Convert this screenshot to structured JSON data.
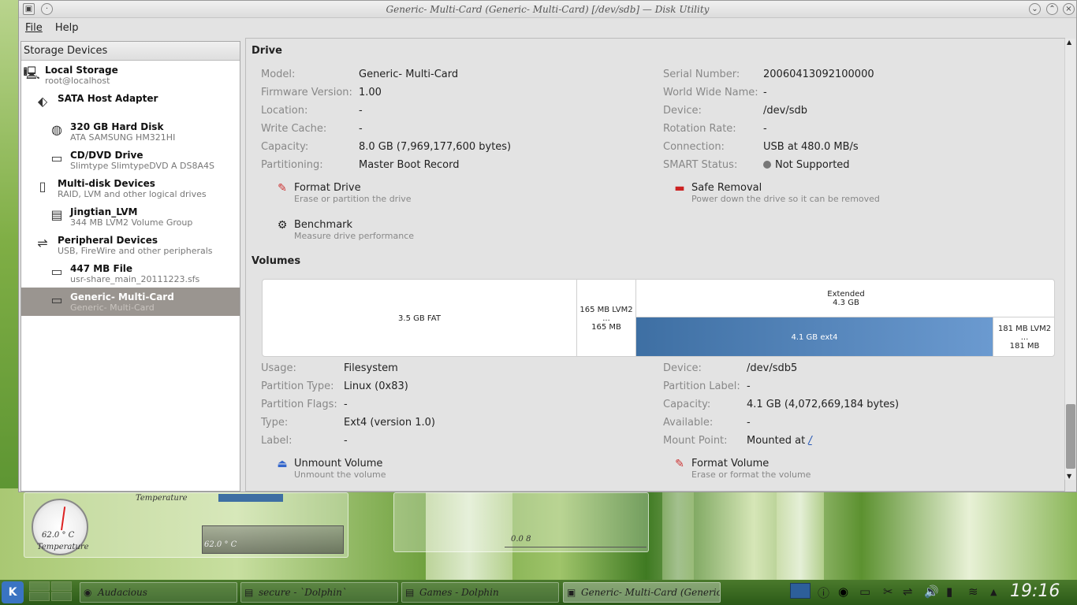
{
  "window": {
    "title": "Generic- Multi-Card (Generic- Multi-Card) [/dev/sdb] — Disk Utility"
  },
  "menu": {
    "file": "File",
    "help": "Help"
  },
  "sidebar": {
    "header": "Storage Devices",
    "items": [
      {
        "name": "Local Storage",
        "sub": "root@localhost",
        "icon": "computer-icon"
      },
      {
        "name": "SATA Host Adapter",
        "sub": "",
        "icon": "sata-adapter-icon"
      },
      {
        "name": "320 GB Hard Disk",
        "sub": "ATA SAMSUNG HM321HI",
        "icon": "harddisk-icon"
      },
      {
        "name": "CD/DVD Drive",
        "sub": "Slimtype SlimtypeDVD A DS8A4S",
        "icon": "optical-drive-icon"
      },
      {
        "name": "Multi-disk Devices",
        "sub": "RAID, LVM and other logical drives",
        "icon": "multidisk-icon"
      },
      {
        "name": "Jingtian_LVM",
        "sub": "344 MB LVM2 Volume Group",
        "icon": "lvm-icon"
      },
      {
        "name": "Peripheral Devices",
        "sub": "USB, FireWire and other peripherals",
        "icon": "usb-icon"
      },
      {
        "name": "447 MB File",
        "sub": "usr-share_main_20111223.sfs",
        "icon": "file-drive-icon"
      },
      {
        "name": "Generic- Multi-Card",
        "sub": "Generic- Multi-Card",
        "icon": "card-reader-icon"
      }
    ]
  },
  "drive": {
    "heading": "Drive",
    "left": [
      {
        "k": "Model:",
        "v": "Generic- Multi-Card"
      },
      {
        "k": "Firmware Version:",
        "v": "1.00"
      },
      {
        "k": "Location:",
        "v": "-"
      },
      {
        "k": "Write Cache:",
        "v": "-"
      },
      {
        "k": "Capacity:",
        "v": "8.0 GB (7,969,177,600 bytes)"
      },
      {
        "k": "Partitioning:",
        "v": "Master Boot Record"
      }
    ],
    "right": [
      {
        "k": "Serial Number:",
        "v": "20060413092100000"
      },
      {
        "k": "World Wide Name:",
        "v": "-"
      },
      {
        "k": "Device:",
        "v": "/dev/sdb"
      },
      {
        "k": "Rotation Rate:",
        "v": "-"
      },
      {
        "k": "Connection:",
        "v": "USB at 480.0 MB/s"
      },
      {
        "k": "SMART Status:",
        "v": "Not Supported"
      }
    ],
    "actions": {
      "format": {
        "name": "Format Drive",
        "desc": "Erase or partition the drive"
      },
      "safe": {
        "name": "Safe Removal",
        "desc": "Power down the drive so it can be removed"
      },
      "bench": {
        "name": "Benchmark",
        "desc": "Measure drive performance"
      }
    }
  },
  "volumes": {
    "heading": "Volumes",
    "segments": {
      "fat": "3.5 GB FAT",
      "lvm1a": "165 MB LVM2 ...",
      "lvm1b": "165 MB",
      "ext_title": "Extended",
      "ext_size": "4.3 GB",
      "ext4": "4.1 GB ext4",
      "lvm2a": "181 MB LVM2 ...",
      "lvm2b": "181 MB"
    },
    "left": [
      {
        "k": "Usage:",
        "v": "Filesystem"
      },
      {
        "k": "Partition Type:",
        "v": "Linux (0x83)"
      },
      {
        "k": "Partition Flags:",
        "v": "-"
      },
      {
        "k": "Type:",
        "v": "Ext4 (version 1.0)"
      },
      {
        "k": "Label:",
        "v": "-"
      }
    ],
    "right": [
      {
        "k": "Device:",
        "v": "/dev/sdb5"
      },
      {
        "k": "Partition Label:",
        "v": "-"
      },
      {
        "k": "Capacity:",
        "v": "4.1 GB (4,072,669,184 bytes)"
      },
      {
        "k": "Available:",
        "v": "-"
      },
      {
        "k": "Mount Point:",
        "v": "Mounted at",
        "link": "/"
      }
    ],
    "actions": {
      "unmount": {
        "name": "Unmount Volume",
        "desc": "Unmount the volume"
      },
      "format": {
        "name": "Format Volume",
        "desc": "Erase or format the volume"
      }
    }
  },
  "desktop": {
    "temp_label1": "Temperature",
    "temp_label2": "Temperature",
    "temp_value": "62.0 ° C",
    "plot_value": "62.0 ° C",
    "meter_value": "0.0 8"
  },
  "taskbar": {
    "tasks": [
      "Audacious",
      "secure - `Dolphin`",
      "Games - Dolphin",
      "Generic- Multi-Card (Generic"
    ],
    "clock": "19:16"
  }
}
